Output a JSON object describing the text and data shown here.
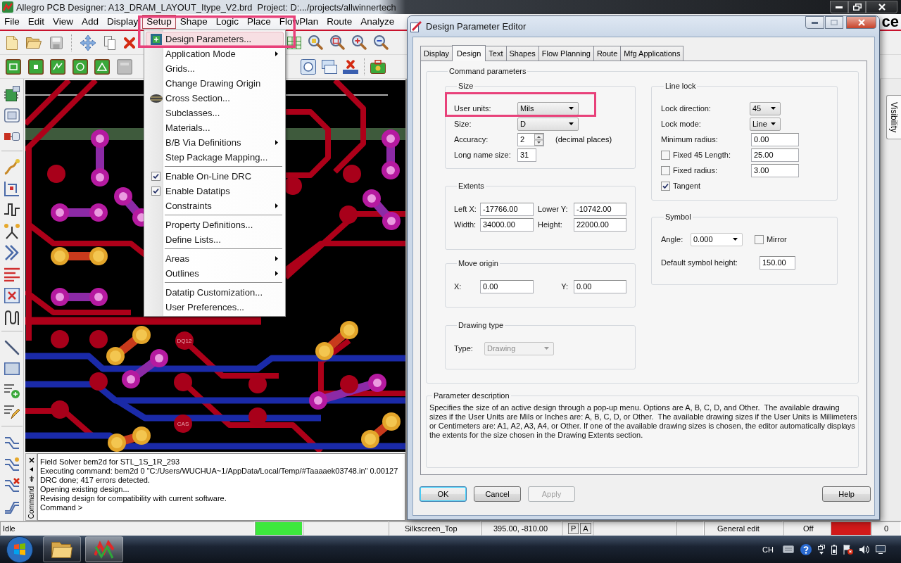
{
  "window": {
    "title": "Allegro PCB Designer: A13_DRAM_LAYOUT_Itype_V2.brd  Project: D:.../projects/allwinnertech",
    "logo_fragment": "ce"
  },
  "menu_bar": [
    {
      "label": "File",
      "selected": false
    },
    {
      "label": "Edit",
      "selected": false
    },
    {
      "label": "View",
      "selected": false
    },
    {
      "label": "Add",
      "selected": false
    },
    {
      "label": "Display",
      "selected": false
    },
    {
      "label": "Setup",
      "selected": true
    },
    {
      "label": "Shape",
      "selected": false
    },
    {
      "label": "Logic",
      "selected": false
    },
    {
      "label": "Place",
      "selected": false
    },
    {
      "label": "FlowPlan",
      "selected": false
    },
    {
      "label": "Route",
      "selected": false
    },
    {
      "label": "Analyze",
      "selected": false
    }
  ],
  "setup_menu": {
    "groups": [
      [
        {
          "kind": "icon_command",
          "label": "Design Parameters...",
          "selected": true
        },
        {
          "kind": "submenu",
          "label": "Application Mode",
          "selected": false
        },
        {
          "kind": "command",
          "label": "Grids...",
          "selected": false
        },
        {
          "kind": "command",
          "label": "Change Drawing Origin",
          "selected": false
        },
        {
          "kind": "icon_command",
          "label": "Cross Section...",
          "selected": false
        },
        {
          "kind": "command",
          "label": "Subclasses...",
          "selected": false
        },
        {
          "kind": "command",
          "label": "Materials...",
          "selected": false
        },
        {
          "kind": "submenu",
          "label": "B/B Via Definitions",
          "selected": false
        },
        {
          "kind": "command",
          "label": "Step Package Mapping...",
          "selected": false
        }
      ],
      [
        {
          "kind": "toggle",
          "label": "Enable On-Line DRC",
          "checked": true,
          "selected": false
        },
        {
          "kind": "toggle",
          "label": "Enable Datatips",
          "checked": true,
          "selected": false
        },
        {
          "kind": "submenu",
          "label": "Constraints",
          "selected": false
        }
      ],
      [
        {
          "kind": "command",
          "label": "Property Definitions...",
          "selected": false
        },
        {
          "kind": "command",
          "label": "Define Lists...",
          "selected": false
        }
      ],
      [
        {
          "kind": "submenu",
          "label": "Areas",
          "selected": false
        },
        {
          "kind": "submenu",
          "label": "Outlines",
          "selected": false
        }
      ],
      [
        {
          "kind": "command",
          "label": "Datatip Customization...",
          "selected": false
        },
        {
          "kind": "command",
          "label": "User Preferences...",
          "selected": false
        }
      ]
    ]
  },
  "canvas": {
    "labels": [
      "DQ12",
      "CAS"
    ]
  },
  "console": {
    "tab_label": "Command",
    "lines": [
      "Field Solver bem2d for STL_1S_1R_293",
      "Executing command: bem2d 0 \"C:/Users/WUCHUA~1/AppData/Local/Temp/#Taaaaek03748.in\" 0.00127",
      "DRC done; 417 errors detected.",
      "Opening existing design...",
      "Revising design for compatibility with current software."
    ],
    "prompt": "Command >"
  },
  "side_panel": {
    "tab": "Visibility"
  },
  "status_bar": {
    "state": "Idle",
    "subclass": "Silkscreen_Top",
    "coordinates": "395.00, -810.00",
    "toggles": [
      "P",
      "A"
    ],
    "mode": "General edit",
    "setting": "Off",
    "count": "0"
  },
  "taskbar": {
    "language": "CH"
  },
  "dialog": {
    "title": "Design Parameter Editor",
    "tabs": [
      {
        "label": "Display",
        "selected": false
      },
      {
        "label": "Design",
        "selected": true
      },
      {
        "label": "Text",
        "selected": false
      },
      {
        "label": "Shapes",
        "selected": false
      },
      {
        "label": "Flow Planning",
        "selected": false
      },
      {
        "label": "Route",
        "selected": false
      },
      {
        "label": "Mfg Applications",
        "selected": false
      }
    ],
    "command_parameters": {
      "title": "Command parameters",
      "size": {
        "title": "Size",
        "user_units": {
          "label": "User units:",
          "value": "Mils"
        },
        "size": {
          "label": "Size:",
          "value": "D"
        },
        "accuracy": {
          "label": "Accuracy:",
          "value": "2",
          "note": "(decimal places)"
        },
        "long_name_size": {
          "label": "Long name size:",
          "value": "31"
        }
      },
      "extents": {
        "title": "Extents",
        "fields": [
          {
            "label": "Left X:",
            "value": "-17766.00"
          },
          {
            "label": "Lower Y:",
            "value": "-10742.00"
          },
          {
            "label": "Width:",
            "value": "34000.00"
          },
          {
            "label": "Height:",
            "value": "22000.00"
          }
        ]
      },
      "move_origin": {
        "title": "Move origin",
        "fields": [
          {
            "label": "X:",
            "value": "0.00"
          },
          {
            "label": "Y:",
            "value": "0.00"
          }
        ]
      },
      "drawing_type": {
        "title": "Drawing type",
        "label": "Type:",
        "value": "Drawing",
        "disabled": true
      },
      "line_lock": {
        "title": "Line lock",
        "rows": [
          {
            "kind": "dropdown",
            "label": "Lock direction:",
            "value": "45"
          },
          {
            "kind": "dropdown",
            "label": "Lock mode:",
            "value": "Line"
          },
          {
            "kind": "input",
            "label": "Minimum radius:",
            "value": "0.00"
          },
          {
            "kind": "check_input",
            "label": "Fixed 45 Length:",
            "checked": false,
            "value": "25.00"
          },
          {
            "kind": "check_input",
            "label": "Fixed radius:",
            "checked": false,
            "value": "3.00"
          },
          {
            "kind": "check",
            "label": "Tangent",
            "checked": true
          }
        ]
      },
      "symbol": {
        "title": "Symbol",
        "angle": {
          "label": "Angle:",
          "value": "0.000"
        },
        "mirror": {
          "label": "Mirror",
          "checked": false
        },
        "default_height": {
          "label": "Default symbol height:",
          "value": "150.00"
        }
      }
    },
    "description": {
      "title": "Parameter description",
      "text": "Specifies the size of an active design through a pop-up menu. Options are A, B, C, D, and Other.  The available drawing\nsizes if the User Units are Mils or Inches are: A, B, C, D, or Other.  The available drawing sizes if the User Units is Millimeters\nor Centimeters are: A1, A2, A3, A4, or Other. If one of the available drawing sizes is chosen, the editor automatically displays\nthe extents for the size chosen in the Drawing Extents section."
    },
    "buttons": [
      {
        "label": "OK",
        "default": true,
        "disabled": false
      },
      {
        "label": "Cancel",
        "default": false,
        "disabled": false
      },
      {
        "label": "Apply",
        "default": false,
        "disabled": true
      },
      {
        "label": "Help",
        "default": false,
        "disabled": false
      }
    ]
  }
}
